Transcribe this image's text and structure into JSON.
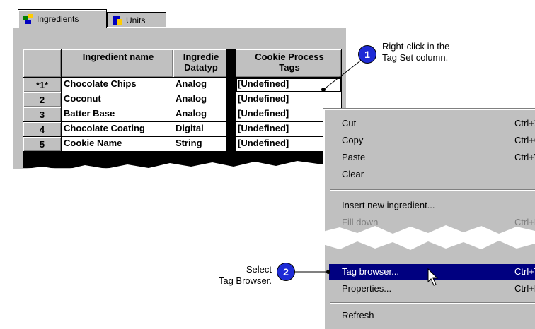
{
  "tabs": [
    {
      "label": "Ingredients",
      "icon": "ingredients-icon"
    },
    {
      "label": "Units",
      "icon": "units-icon"
    }
  ],
  "grid": {
    "headers": {
      "name": "Ingredient name",
      "datatype": "Ingredie Datatyp",
      "tags": "Cookie Process Tags"
    },
    "rows": [
      {
        "num": "*1*",
        "name": "Chocolate Chips",
        "type": "Analog",
        "tags": "[Undefined]"
      },
      {
        "num": "2",
        "name": "Coconut",
        "type": "Analog",
        "tags": "[Undefined]"
      },
      {
        "num": "3",
        "name": "Batter Base",
        "type": "Analog",
        "tags": "[Undefined]"
      },
      {
        "num": "4",
        "name": "Chocolate Coating",
        "type": "Digital",
        "tags": "[Undefined]"
      },
      {
        "num": "5",
        "name": "Cookie Name",
        "type": "String",
        "tags": "[Undefined]"
      }
    ]
  },
  "menu": {
    "items": [
      {
        "label": "Cut",
        "accel": "Ctrl+X"
      },
      {
        "label": "Copy",
        "accel": "Ctrl+C"
      },
      {
        "label": "Paste",
        "accel": "Ctrl+V"
      },
      {
        "label": "Clear",
        "accel": ""
      },
      {
        "label": "Insert new ingredient...",
        "accel": ""
      },
      {
        "label": "Fill down",
        "accel": "Ctrl+F"
      },
      {
        "label": "Tag browser...",
        "accel": "Ctrl+T"
      },
      {
        "label": "Properties...",
        "accel": "Ctrl+R"
      },
      {
        "label": "Refresh",
        "accel": ""
      }
    ]
  },
  "callouts": {
    "step1": {
      "number": "1",
      "text_line1": "Right-click in the",
      "text_line2": "Tag Set column."
    },
    "step2": {
      "number": "2",
      "text_line1": "Select",
      "text_line2": "Tag Browser."
    }
  },
  "colors": {
    "badge": "#1e2bd6",
    "highlight": "#000080",
    "chrome": "#c0c0c0"
  }
}
